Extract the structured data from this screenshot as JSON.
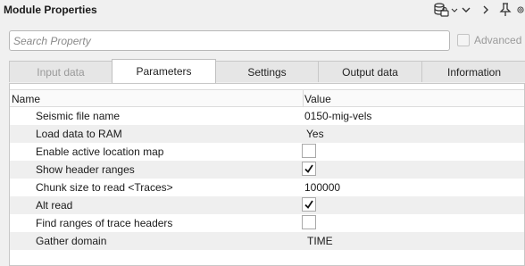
{
  "header": {
    "title": "Module Properties",
    "icons": [
      "database-lock-icon",
      "chevron-down-icon",
      "chevron-right-icon",
      "pin-icon",
      "gear-icon"
    ]
  },
  "search": {
    "placeholder": "Search Property",
    "advanced_label": "Advanced",
    "advanced_checked": false
  },
  "tabs": [
    {
      "label": "Input data",
      "state": "disabled"
    },
    {
      "label": "Parameters",
      "state": "active"
    },
    {
      "label": "Settings",
      "state": "normal"
    },
    {
      "label": "Output data",
      "state": "normal"
    },
    {
      "label": "Information",
      "state": "normal"
    }
  ],
  "table": {
    "columns": [
      "Name",
      "Value"
    ],
    "rows": [
      {
        "name": "Seismic file name",
        "value": "0150-mig-vels",
        "kind": "text"
      },
      {
        "name": "Load data to RAM",
        "value": "Yes",
        "kind": "text"
      },
      {
        "name": "Enable active location map",
        "checked": false,
        "kind": "checkbox"
      },
      {
        "name": "Show header ranges",
        "checked": true,
        "kind": "checkbox"
      },
      {
        "name": "Chunk size to read <Traces>",
        "value": "100000",
        "kind": "text"
      },
      {
        "name": "Alt read",
        "checked": true,
        "kind": "checkbox"
      },
      {
        "name": "Find ranges of trace headers",
        "checked": false,
        "kind": "checkbox"
      },
      {
        "name": "Gather domain",
        "value": "TIME",
        "kind": "text"
      }
    ]
  }
}
